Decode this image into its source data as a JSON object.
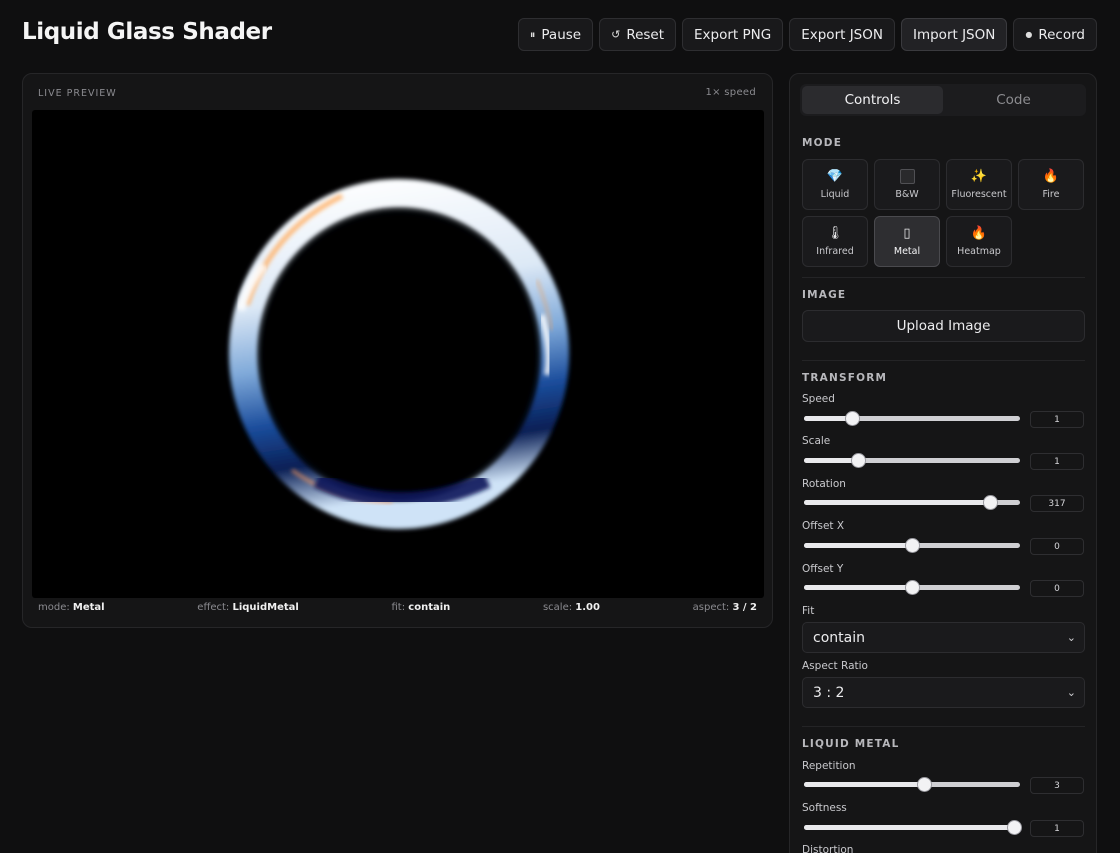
{
  "app": {
    "title": "Liquid Glass Shader"
  },
  "toolbar": {
    "pause_icon": "pause-icon",
    "pause_label": "Pause",
    "reset_icon": "reset-icon",
    "reset_label": "Reset",
    "export_png_label": "Export PNG",
    "export_json_label": "Export JSON",
    "import_json_label": "Import JSON",
    "record_icon": "record-dot-icon",
    "record_label": "Record"
  },
  "preview": {
    "label": "LIVE PREVIEW",
    "speed": "1× speed",
    "stats": {
      "mode_key": "mode:",
      "mode_value": "Metal",
      "effect_key": "effect:",
      "effect_value": "LiquidMetal",
      "fit_key": "fit:",
      "fit_value": "contain",
      "scale_key": "scale:",
      "scale_value": "1.00",
      "aspect_key": "aspect:",
      "aspect_value": "3 / 2"
    }
  },
  "tabs": [
    {
      "label": "Controls",
      "active": true
    },
    {
      "label": "Code",
      "active": false
    }
  ],
  "sections": {
    "mode": "MODE",
    "image": "IMAGE",
    "transform": "TRANSFORM",
    "liquid_metal": "LIQUID METAL"
  },
  "modes": [
    {
      "label": "Liquid",
      "icon": "gem-icon",
      "glyph": "💎",
      "active": false
    },
    {
      "label": "B&W",
      "icon": "square-icon",
      "glyph": "",
      "active": false
    },
    {
      "label": "Fluorescent",
      "icon": "sparkles-icon",
      "glyph": "✨",
      "active": false
    },
    {
      "label": "Fire",
      "icon": "fire-icon",
      "glyph": "🔥",
      "active": false
    },
    {
      "label": "Infrared",
      "icon": "thermometer-icon",
      "glyph": "🌡",
      "active": false
    },
    {
      "label": "Metal",
      "icon": "rectangle-icon",
      "glyph": "▯",
      "active": true
    },
    {
      "label": "Heatmap",
      "icon": "fire-icon",
      "glyph": "🔥",
      "active": false
    }
  ],
  "image": {
    "upload_label": "Upload Image"
  },
  "transform": {
    "speed": {
      "label": "Speed",
      "value": "1",
      "fraction": 0.22
    },
    "scale": {
      "label": "Scale",
      "value": "1",
      "fraction": 0.25
    },
    "rotation": {
      "label": "Rotation",
      "value": "317",
      "fraction": 0.86
    },
    "offset_x": {
      "label": "Offset X",
      "value": "0",
      "fraction": 0.5
    },
    "offset_y": {
      "label": "Offset Y",
      "value": "0",
      "fraction": 0.5
    },
    "fit": {
      "label": "Fit",
      "value": "contain"
    },
    "aspect": {
      "label": "Aspect Ratio",
      "value": "3 : 2"
    }
  },
  "liquid_metal": {
    "repetition": {
      "label": "Repetition",
      "value": "3",
      "fraction": 0.555
    },
    "softness": {
      "label": "Softness",
      "value": "1",
      "fraction": 0.97
    },
    "distortion": {
      "label": "Distortion"
    }
  },
  "colors": {
    "background": "#0f0f10",
    "panel": "#151516",
    "accent": "#f2f2f4",
    "ring_blue": "#1a4fa0"
  }
}
